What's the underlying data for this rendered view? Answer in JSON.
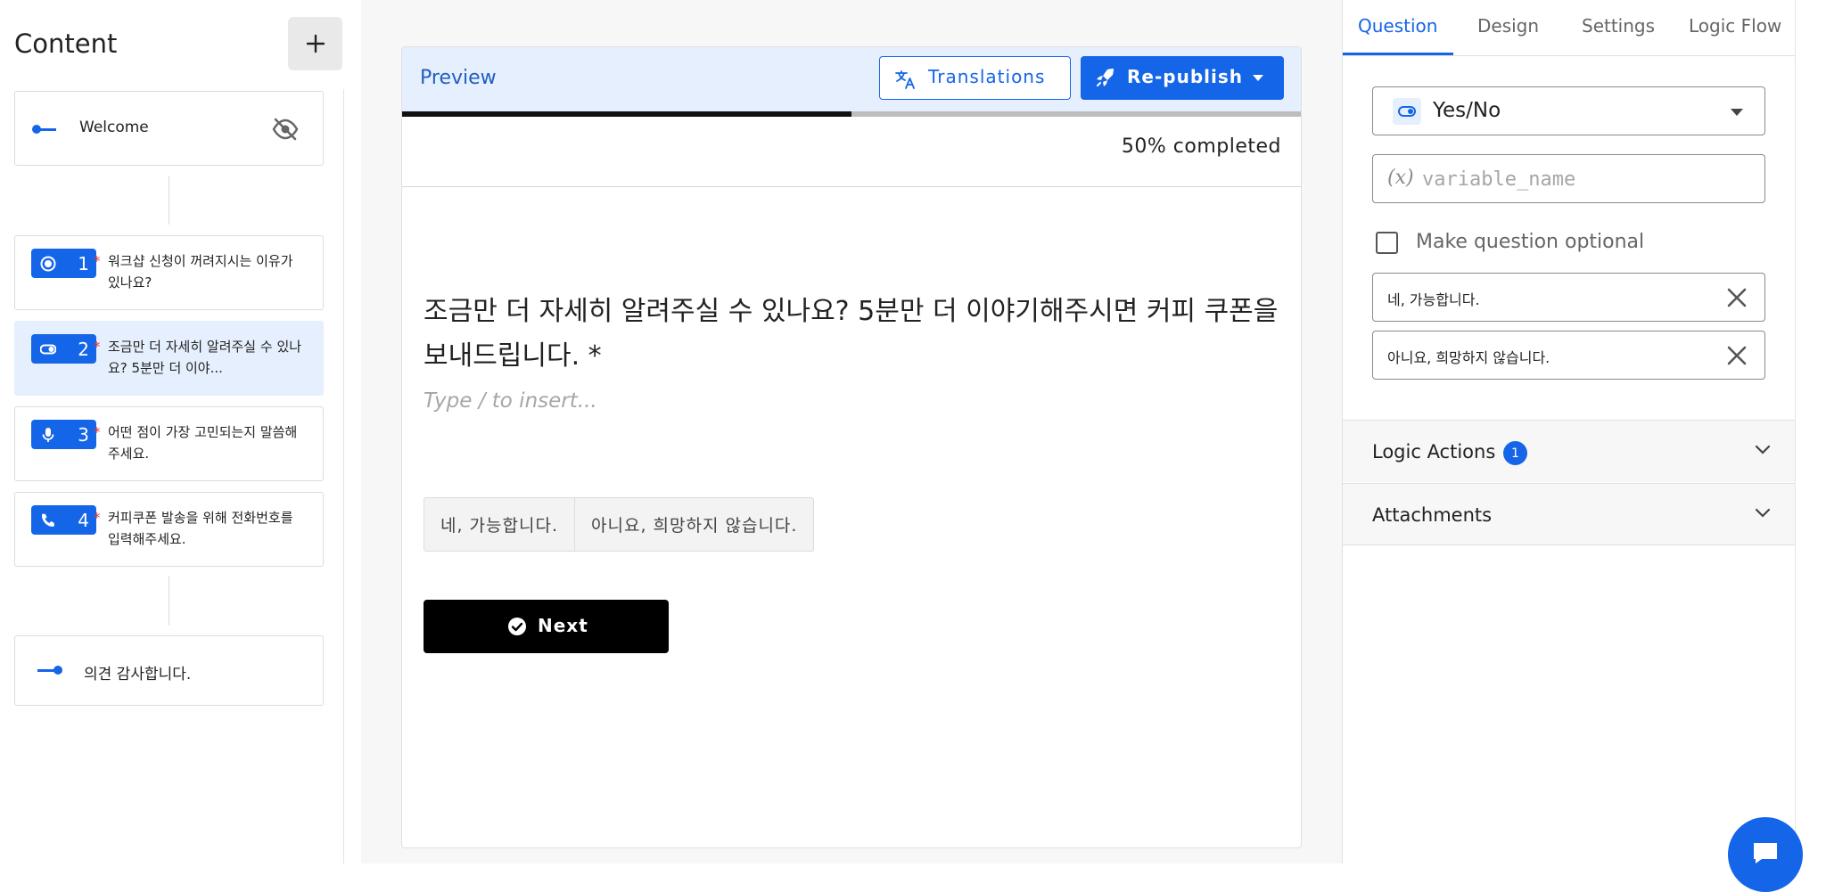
{
  "sidebar": {
    "title": "Content",
    "add_button": "+",
    "welcome": {
      "label": "Welcome",
      "icon": "eye-off-icon"
    },
    "questions": [
      {
        "number": "1",
        "icon": "radio-icon",
        "text": "워크샵 신청이 꺼려지시는 이유가 있나요?",
        "required": "*"
      },
      {
        "number": "2",
        "icon": "toggle-icon",
        "text": "조금만 더 자세히 알려주실 수 있나요? 5분만 더 이야...",
        "required": "*",
        "active": true
      },
      {
        "number": "3",
        "icon": "microphone-icon",
        "text": "어떤 점이 가장 고민되는지 말씀해주세요.",
        "required": "*"
      },
      {
        "number": "4",
        "icon": "phone-icon",
        "text": "커피쿠폰 발송을 위해 전화번호를 입력해주세요.",
        "required": "*"
      }
    ],
    "ending": {
      "label": "의견 감사합니다."
    }
  },
  "preview": {
    "label": "Preview",
    "translations_button": "Translations",
    "republish_button": "Re-publish",
    "progress_fraction": 0.5,
    "progress_text": "50% completed",
    "question_title": "조금만 더 자세히 알려주실 수 있나요? 5분만 더 이야기해주시면 커피 쿠폰을 보내드립니다. *",
    "description_placeholder": "Type / to insert...",
    "choices": [
      "네, 가능합니다.",
      "아니요, 희망하지 않습니다."
    ],
    "next_button": "Next"
  },
  "panel": {
    "tabs": [
      "Question",
      "Design",
      "Settings",
      "Logic Flow"
    ],
    "active_tab": "Question",
    "type_select": "Yes/No",
    "variable_prefix": "(x)",
    "variable_placeholder": "variable_name",
    "optional_label": "Make question optional",
    "options": [
      "네, 가능합니다.",
      "아니요, 희망하지 않습니다."
    ],
    "logic_actions_label": "Logic Actions",
    "logic_actions_count": "1",
    "attachments_label": "Attachments"
  },
  "colors": {
    "accent": "#1565e8",
    "active_card": "#e6effd",
    "required": "#e53935",
    "next_button": "#000000"
  }
}
